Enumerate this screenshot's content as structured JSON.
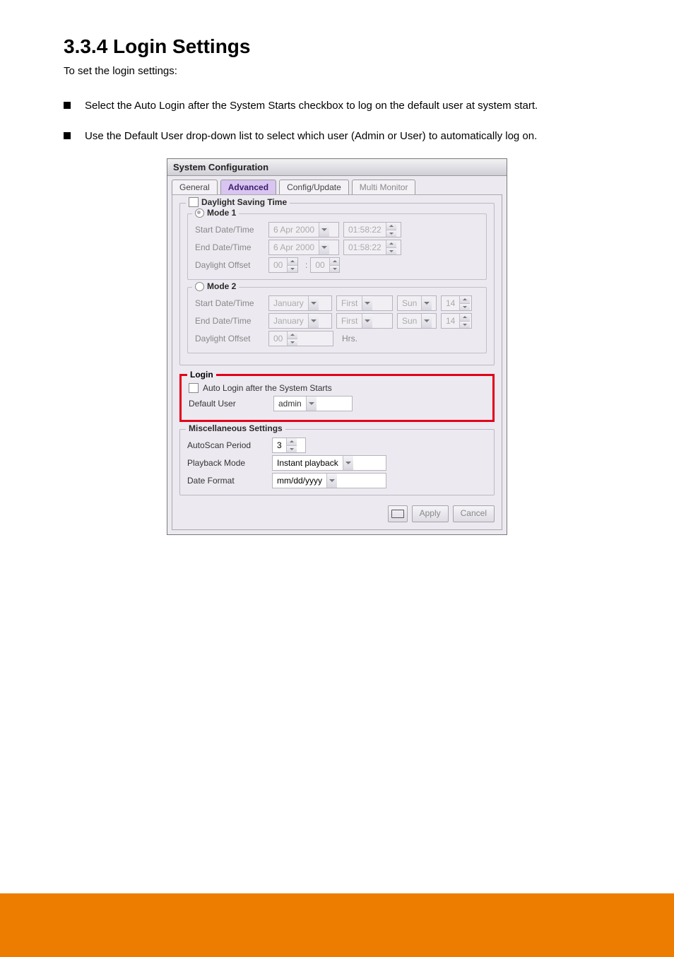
{
  "heading": "3.3.4    Login Settings",
  "subtext": "To set the login settings:",
  "bullets": [
    "Select the Auto Login after the System Starts checkbox to log on the default user at system start.",
    "Use the Default User drop-down list to select which user (Admin or User) to automatically log on."
  ],
  "dialog": {
    "title": "System Configuration",
    "tabs": [
      "General",
      "Advanced",
      "Config/Update",
      "Multi Monitor"
    ],
    "active_tab": "Advanced",
    "dst": {
      "legend": "Daylight Saving Time",
      "mode1": {
        "legend": "Mode 1",
        "start_label": "Start Date/Time",
        "end_label": "End Date/Time",
        "offset_label": "Daylight Offset",
        "date": "6 Apr 2000",
        "time": "01:58:22",
        "offset_h": "00",
        "offset_m": "00"
      },
      "mode2": {
        "legend": "Mode 2",
        "start_label": "Start Date/Time",
        "end_label": "End Date/Time",
        "offset_label": "Daylight Offset",
        "month": "January",
        "week": "First",
        "day": "Sun",
        "hour": "14",
        "offset": "00",
        "hrs_suffix": "Hrs."
      }
    },
    "login": {
      "legend": "Login",
      "auto_label": "Auto Login after the System Starts",
      "default_user_label": "Default User",
      "default_user_value": "admin"
    },
    "misc": {
      "legend": "Miscellaneous Settings",
      "autoscan_label": "AutoScan Period",
      "autoscan_value": "3",
      "playback_label": "Playback Mode",
      "playback_value": "Instant playback",
      "dateformat_label": "Date Format",
      "dateformat_value": "mm/dd/yyyy"
    },
    "buttons": {
      "apply": "Apply",
      "cancel": "Cancel"
    }
  }
}
